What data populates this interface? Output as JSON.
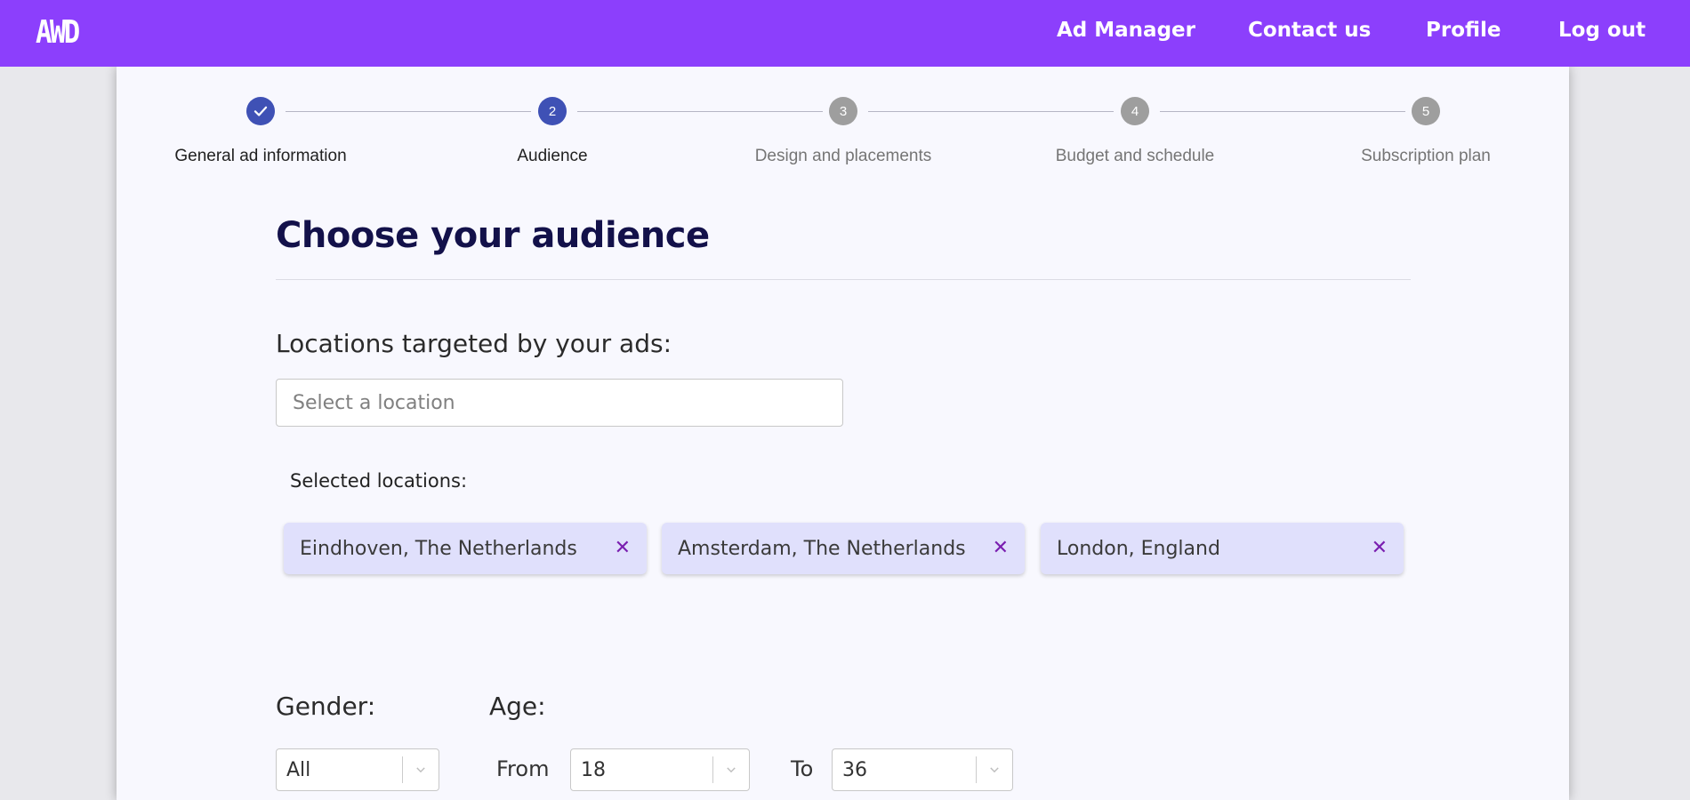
{
  "header": {
    "logo_text": "AWD",
    "nav": [
      {
        "label": "Ad Manager"
      },
      {
        "label": "Contact us"
      },
      {
        "label": "Profile"
      },
      {
        "label": "Log out"
      }
    ]
  },
  "stepper": {
    "steps": [
      {
        "number": "1",
        "label": "General ad information",
        "state": "completed"
      },
      {
        "number": "2",
        "label": "Audience",
        "state": "active"
      },
      {
        "number": "3",
        "label": "Design and placements",
        "state": "pending"
      },
      {
        "number": "4",
        "label": "Budget and schedule",
        "state": "pending"
      },
      {
        "number": "5",
        "label": "Subscription plan",
        "state": "pending"
      }
    ]
  },
  "main": {
    "title": "Choose your audience",
    "locations_label": "Locations targeted by your ads:",
    "location_input": {
      "placeholder": "Select a location",
      "value": ""
    },
    "selected_label": "Selected locations:",
    "selected_locations": [
      {
        "label": "Eindhoven, The Netherlands",
        "remove_icon": "close-icon"
      },
      {
        "label": "Amsterdam, The Netherlands",
        "remove_icon": "close-icon"
      },
      {
        "label": "London, England",
        "remove_icon": "close-icon"
      }
    ],
    "gender": {
      "label": "Gender:",
      "value": "All"
    },
    "age": {
      "label": "Age:",
      "from_label": "From",
      "from_value": "18",
      "to_label": "To",
      "to_value": "36"
    }
  },
  "colors": {
    "brand": "#8c3ffc",
    "step_active": "#3f51b5",
    "step_pending": "#9e9e9e",
    "title": "#13114a",
    "chip_bg": "#e0e0fc",
    "chip_remove": "#7a1fb0"
  }
}
